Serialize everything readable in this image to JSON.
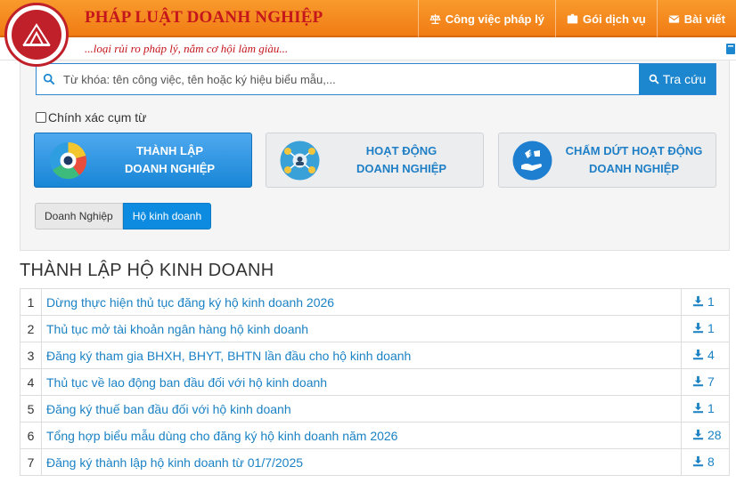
{
  "brand": {
    "title": "PHÁP LUẬT DOANH NGHIỆP",
    "slogan": "...loại rủi ro pháp lý, nắm cơ hội làm giàu..."
  },
  "nav": [
    {
      "label": "Công việc pháp lý",
      "icon": "scale-icon"
    },
    {
      "label": "Gói dịch vụ",
      "icon": "package-icon"
    },
    {
      "label": "Bài viết",
      "icon": "envelope-icon"
    }
  ],
  "search": {
    "placeholder": "Từ khóa: tên công việc, tên hoặc ký hiệu biểu mẫu,...",
    "value": "",
    "button_label": "Tra cứu",
    "exact_label": "Chính xác cụm từ",
    "exact_checked": false
  },
  "categories": [
    {
      "line1": "THÀNH LẬP",
      "line2": "DOANH NGHIỆP",
      "active": true,
      "icon": "pie-chart-icon"
    },
    {
      "line1": "HOẠT ĐỘNG",
      "line2": "DOANH NGHIỆP",
      "active": false,
      "icon": "business-network-icon"
    },
    {
      "line1": "CHẤM DỨT HOẠT ĐỘNG",
      "line2": "DOANH NGHIỆP",
      "active": false,
      "icon": "money-hands-icon"
    }
  ],
  "tabs": [
    {
      "label": "Doanh Nghiệp",
      "active": false
    },
    {
      "label": "Hộ kinh doanh",
      "active": true
    }
  ],
  "section_title": "THÀNH LẬP HỘ KINH DOANH",
  "items": [
    {
      "num": "1",
      "title": "Dừng thực hiện thủ tục đăng ký hộ kinh doanh 2026",
      "downloads": "1"
    },
    {
      "num": "2",
      "title": "Thủ tục mở tài khoản ngân hàng hộ kinh doanh",
      "downloads": "1"
    },
    {
      "num": "3",
      "title": "Đăng ký tham gia BHXH, BHYT, BHTN lần đầu cho hộ kinh doanh",
      "downloads": "4"
    },
    {
      "num": "4",
      "title": "Thủ tục về lao động ban đầu đối với hộ kinh doanh",
      "downloads": "7"
    },
    {
      "num": "5",
      "title": "Đăng ký thuế ban đầu đối với hộ kinh doanh",
      "downloads": "1"
    },
    {
      "num": "6",
      "title": "Tổng hợp biểu mẫu dùng cho đăng ký hộ kinh doanh năm 2026",
      "downloads": "28"
    },
    {
      "num": "7",
      "title": "Đăng ký thành lập hộ kinh doanh từ 01/7/2025",
      "downloads": "8"
    }
  ],
  "colors": {
    "header_orange": "#f58a22",
    "brand_red": "#c4161c",
    "accent_blue": "#1c87cf",
    "link_blue": "#1b82c4"
  }
}
